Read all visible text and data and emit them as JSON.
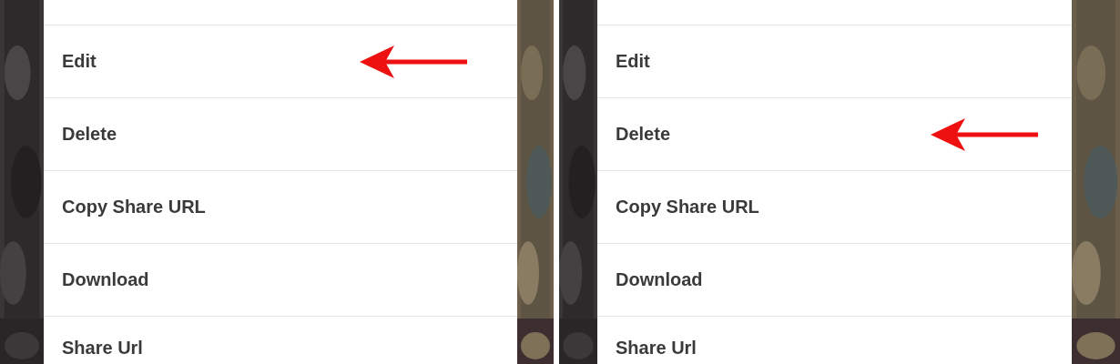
{
  "panels": [
    {
      "menu": [
        {
          "label": "Edit",
          "pointed": true
        },
        {
          "label": "Delete",
          "pointed": false
        },
        {
          "label": "Copy Share URL",
          "pointed": false
        },
        {
          "label": "Download",
          "pointed": false
        },
        {
          "label": "Share Url",
          "pointed": false
        }
      ]
    },
    {
      "menu": [
        {
          "label": "Edit",
          "pointed": false
        },
        {
          "label": "Delete",
          "pointed": true
        },
        {
          "label": "Copy Share URL",
          "pointed": false
        },
        {
          "label": "Download",
          "pointed": false
        },
        {
          "label": "Share Url",
          "pointed": false
        }
      ]
    }
  ]
}
